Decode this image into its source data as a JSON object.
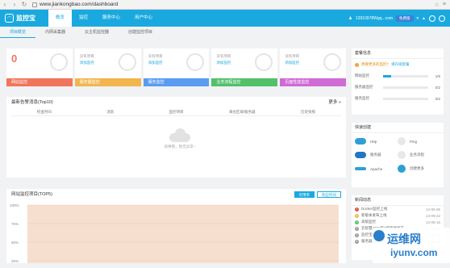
{
  "browser": {
    "url": "www.jiankongbao.com/dashboard"
  },
  "app": {
    "logo": "监控宝",
    "user": "13910978Wgq...com",
    "user_badge": "免费版"
  },
  "nav": [
    "概览",
    "监控",
    "服务中心",
    "用户中心"
  ],
  "subtabs": [
    "项目概览",
    "内网采集器",
    "云主机监控器",
    "创建监控项目"
  ],
  "cards": [
    {
      "big": "0",
      "sub1": "",
      "sub2": "",
      "label": "网站监控",
      "color": "#f0755a"
    },
    {
      "big": "",
      "sub1": "没有项目",
      "sub2": "添加监控",
      "label": "服务器监控",
      "color": "#f2b64f"
    },
    {
      "big": "",
      "sub1": "没有项目",
      "sub2": "添加监控",
      "label": "服务监控",
      "color": "#5b9cf0"
    },
    {
      "big": "",
      "sub1": "没有项目",
      "sub2": "添加监控",
      "label": "业务流程监控",
      "color": "#53c06a"
    },
    {
      "big": "",
      "sub1": "没有项目",
      "sub2": "添加监控",
      "label": "页面性能监控",
      "color": "#d06bd6"
    }
  ],
  "alerts": {
    "title": "最新告警消息(Top10)",
    "more": "更多 »",
    "columns": [
      "检查时间",
      "消息",
      "监控项目",
      "来也区域/服务器",
      "历史快照"
    ],
    "empty": "很棒哦，暂无异常~"
  },
  "chart": {
    "title": "网站监控项目(TOP5)",
    "tabs": [
      "可用率",
      "响应时间"
    ],
    "yticks": [
      "100%",
      "75%",
      "50%",
      "25%"
    ]
  },
  "right": {
    "overview_title": "套餐信息",
    "warning": "想要更多的监控?",
    "warning_link": "请升级套餐",
    "stats": [
      {
        "label": "网站监控",
        "count": "1/6",
        "fill": 0.17
      },
      {
        "label": "服务器监控",
        "count": "0/2",
        "fill": 0
      },
      {
        "label": "服务监控",
        "count": "0/2",
        "fill": 0
      }
    ],
    "quick_title": "快速创建",
    "quick": [
      {
        "label": "Http",
        "icon": "cloud-icon"
      },
      {
        "label": "Ping",
        "icon": "ping-icon"
      },
      {
        "label": "服务器",
        "icon": "server-icon"
      },
      {
        "label": "业务流程",
        "icon": "flow-icon"
      },
      {
        "label": "Apache",
        "icon": "apache-icon"
      },
      {
        "label": "创建更多",
        "icon": "plus-icon"
      }
    ],
    "news_title": "新闻动态",
    "news": [
      {
        "n": "1",
        "text": "Docker监控上线",
        "date": "14-06-06",
        "color": "#e24a3b"
      },
      {
        "n": "2",
        "text": "新版本发布上线",
        "date": "13-09-22",
        "color": "#f2b64f"
      },
      {
        "n": "3",
        "text": "高级监控",
        "date": "13-08-16",
        "color": "#53c06a"
      },
      {
        "n": "4",
        "text": "云智慧2015年7月新闻发布",
        "date": "13-08-05",
        "color": "#999999"
      },
      {
        "n": "5",
        "text": "监控宝旗舰版",
        "date": "13-06-16",
        "color": "#999999"
      },
      {
        "n": "6",
        "text": "服务器监控插件",
        "date": "13-06-16",
        "color": "#999999"
      }
    ]
  },
  "watermark": {
    "line1": "运维网",
    "line2": "iyunv.com"
  }
}
